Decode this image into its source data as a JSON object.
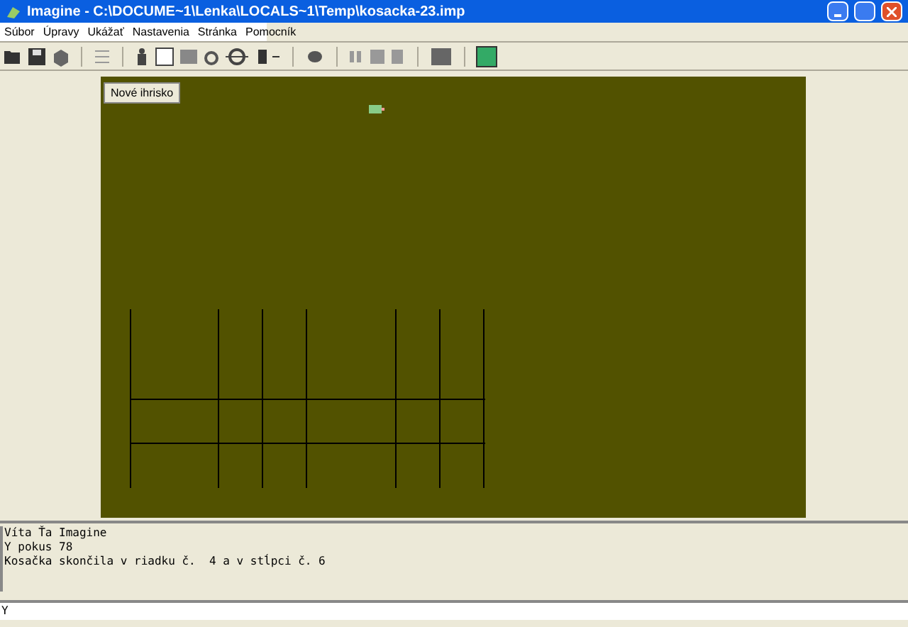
{
  "window": {
    "title": "Imagine - C:\\DOCUME~1\\Lenka\\LOCALS~1\\Temp\\kosacka-23.imp"
  },
  "menu": [
    "Súbor",
    "Úpravy",
    "Ukážať",
    "Nastavenia",
    "Stránka",
    "Pomocník"
  ],
  "canvas": {
    "button": "Nové ihrisko"
  },
  "output": [
    "Víta Ťa Imagine",
    "Y pokus 78",
    "Kosačka skončila v riadku č.  4 a v stĺpci č. 6"
  ],
  "command_line": {
    "value": "Y"
  }
}
